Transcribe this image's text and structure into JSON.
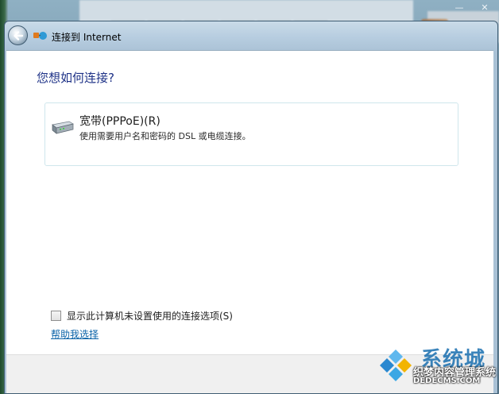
{
  "window": {
    "title": "连接到 Internet",
    "controls": {
      "minimize": "—",
      "close": "✕"
    }
  },
  "main": {
    "heading": "您想如何连接?",
    "options": [
      {
        "title": "宽带(PPPoE)(R)",
        "description": "使用需要用户名和密码的 DSL 或电缆连接。",
        "icon": "modem-icon"
      }
    ],
    "show_unconfigured_checkbox": {
      "label": "显示此计算机未设置使用的连接选项(S)",
      "checked": false
    },
    "help_link": "帮助我选择"
  },
  "watermark": {
    "brand": "系统城",
    "site_name": "织梦内容管理系统",
    "url": "DEDECMS.COM"
  },
  "colors": {
    "heading": "#1e3287",
    "link": "#0b63a8",
    "option_border": "#cfe6ec",
    "footer": "#f0f0f0"
  }
}
